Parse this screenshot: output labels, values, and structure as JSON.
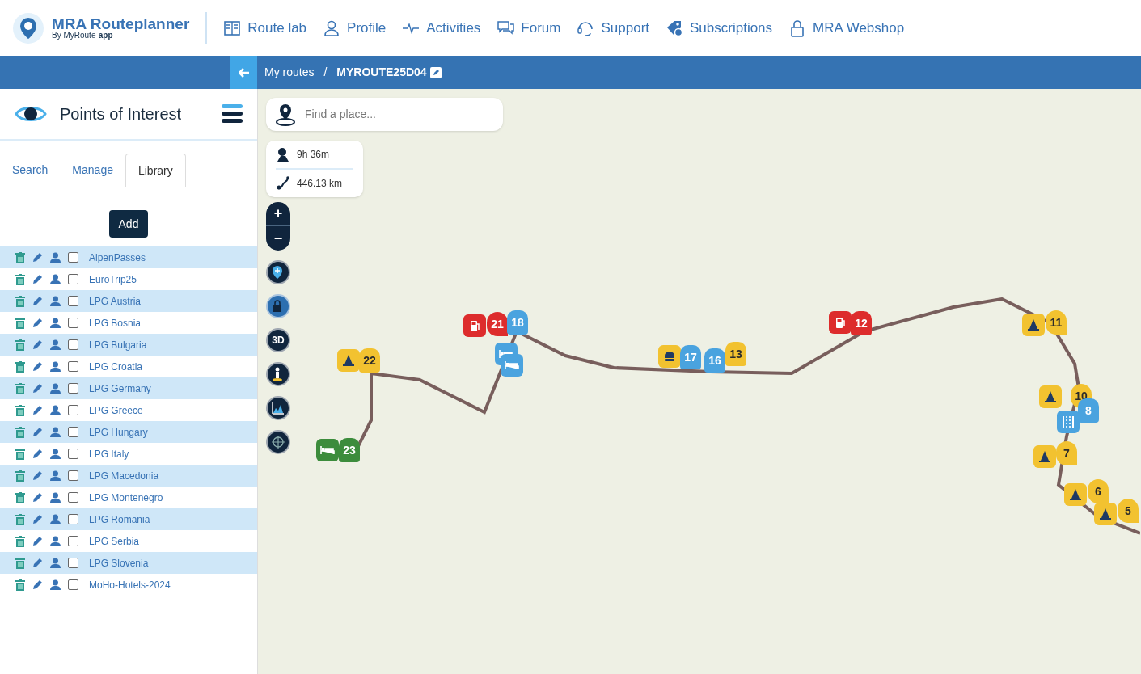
{
  "logo": {
    "title": "MRA Routeplanner",
    "subtitle": "By MyRoute-**app**"
  },
  "nav": [
    {
      "kind": "book",
      "label": "Route lab"
    },
    {
      "kind": "person",
      "label": "Profile"
    },
    {
      "kind": "pulse",
      "label": "Activities"
    },
    {
      "kind": "chat",
      "label": "Forum"
    },
    {
      "kind": "headset",
      "label": "Support"
    },
    {
      "kind": "tag",
      "label": "Subscriptions"
    },
    {
      "kind": "lock",
      "label": "MRA Webshop"
    }
  ],
  "breadcrumb": {
    "parent": "My routes",
    "separator": "/",
    "current": "MYROUTE25D04"
  },
  "sidebar": {
    "title": "Points of Interest",
    "tabs": [
      {
        "label": "Search",
        "selected": false
      },
      {
        "label": "Manage",
        "selected": false
      },
      {
        "label": "Library",
        "selected": true
      }
    ],
    "add_button": "Add",
    "items": [
      {
        "name": "AlpenPasses",
        "checked": false
      },
      {
        "name": "EuroTrip25",
        "checked": false
      },
      {
        "name": "LPG Austria",
        "checked": false
      },
      {
        "name": "LPG Bosnia",
        "checked": false
      },
      {
        "name": "LPG Bulgaria",
        "checked": false
      },
      {
        "name": "LPG Croatia",
        "checked": false
      },
      {
        "name": "LPG Germany",
        "checked": false
      },
      {
        "name": "LPG Greece",
        "checked": false
      },
      {
        "name": "LPG Hungary",
        "checked": false
      },
      {
        "name": "LPG Italy",
        "checked": false
      },
      {
        "name": "LPG Macedonia",
        "checked": false
      },
      {
        "name": "LPG Montenegro",
        "checked": false
      },
      {
        "name": "LPG Romania",
        "checked": false
      },
      {
        "name": "LPG Serbia",
        "checked": false
      },
      {
        "name": "LPG Slovenia",
        "checked": false
      },
      {
        "name": "MoHo-Hotels-2024",
        "checked": false
      }
    ]
  },
  "map": {
    "search": {
      "placeholder": "Find a place..."
    },
    "duration": "9h 36m",
    "distance": "446.13 km",
    "zoom": {
      "in": "+",
      "out": "−"
    },
    "tools": [
      {
        "kind": "pin",
        "active": false
      },
      {
        "kind": "lock",
        "active": true
      },
      {
        "kind": "perspective",
        "label": "3D",
        "active": false
      },
      {
        "kind": "person",
        "active": false
      },
      {
        "kind": "chart",
        "active": false
      },
      {
        "kind": "crosshair",
        "active": false
      }
    ],
    "markers": [
      {
        "kind": "cone",
        "color": "#f2c230"
      },
      {
        "kind": "hand",
        "label": "22",
        "color": "#f2c230"
      },
      {
        "kind": "bed",
        "color": "#3c8c3c"
      },
      {
        "kind": "hand",
        "label": "23",
        "color": "#3c8c3c"
      },
      {
        "kind": "fuel",
        "color": "#dd2c2c"
      },
      {
        "kind": "pin",
        "label": "21",
        "color": "#dd2c2c"
      },
      {
        "kind": "hand",
        "label": "18",
        "color": "#4aa3df"
      },
      {
        "kind": "bed",
        "color": "#4aa3df"
      },
      {
        "kind": "bed",
        "color": "#4aa3df"
      },
      {
        "kind": "burger",
        "color": "#f2c230"
      },
      {
        "kind": "hand",
        "label": "17",
        "color": "#4aa3df"
      },
      {
        "kind": "hand",
        "label": "16",
        "color": "#4aa3df"
      },
      {
        "kind": "hand",
        "label": "13",
        "color": "#f2c230"
      },
      {
        "kind": "fuel",
        "color": "#dd2c2c"
      },
      {
        "kind": "hand",
        "label": "12",
        "color": "#dd2c2c"
      },
      {
        "kind": "cone",
        "color": "#f2c230"
      },
      {
        "kind": "pin",
        "label": "11",
        "color": "#f2c230"
      },
      {
        "kind": "cone",
        "color": "#f2c230"
      },
      {
        "kind": "pin",
        "label": "10",
        "color": "#f2c230"
      },
      {
        "kind": "lanes",
        "color": "#4aa3df"
      },
      {
        "kind": "hand",
        "label": "8",
        "color": "#4aa3df"
      },
      {
        "kind": "cone",
        "color": "#f2c230"
      },
      {
        "kind": "pin",
        "label": "7",
        "color": "#f2c230"
      },
      {
        "kind": "cone",
        "color": "#f2c230"
      },
      {
        "kind": "pin",
        "label": "6",
        "color": "#f2c230"
      },
      {
        "kind": "cone",
        "color": "#f2c230"
      },
      {
        "kind": "pin",
        "label": "5",
        "color": "#f2c230"
      }
    ]
  }
}
